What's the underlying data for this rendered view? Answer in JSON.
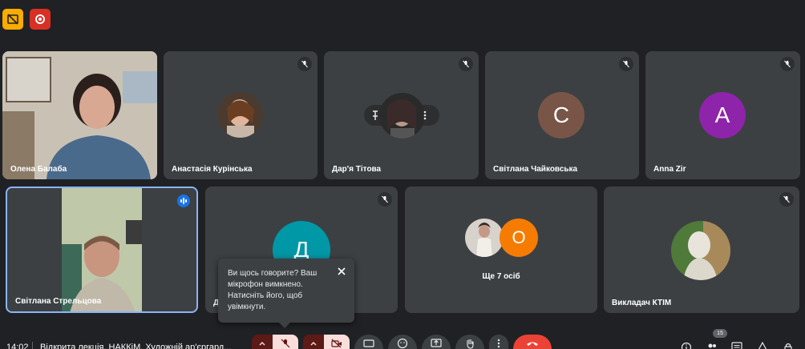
{
  "top_controls": {
    "captions_icon": "closed-captions-off-icon",
    "record_icon": "recording-icon"
  },
  "participants": [
    {
      "name": "Олена Балаба",
      "type": "video",
      "muted": false
    },
    {
      "name": "Анастасія Курінська",
      "type": "photo",
      "muted": true
    },
    {
      "name": "Дар'я Тітова",
      "type": "photo",
      "muted": true
    },
    {
      "name": "Світлана Чайковська",
      "type": "letter",
      "letter": "С",
      "color": "#795548",
      "muted": true
    },
    {
      "name": "Anna Zir",
      "type": "letter",
      "letter": "A",
      "color": "#8e24aa",
      "muted": true
    },
    {
      "name": "Світлана Стрельцова",
      "type": "video",
      "muted": false,
      "speaking": true
    },
    {
      "name": "Д",
      "type": "letter",
      "letter": "Д",
      "color": "#0097a7",
      "muted": true
    },
    {
      "name": "Ще 7 осіб",
      "type": "group",
      "letter": "О",
      "color": "#f57c00",
      "muted": false
    },
    {
      "name": "Викладач КТІМ",
      "type": "photo",
      "muted": true
    }
  ],
  "tooltip": {
    "text": "Ви щось говорите? Ваш мікрофон вимкнено. Натисніть його, щоб увімкнути."
  },
  "bottom_bar": {
    "time": "14:02",
    "meeting_title": "Відкрита лекція. НАККіМ. Художній ар'єргард...",
    "participants_count": "15"
  },
  "colors": {
    "background": "#202124",
    "tile": "#3c4043",
    "accent": "#8ab4f8",
    "end_call": "#ea4335"
  }
}
